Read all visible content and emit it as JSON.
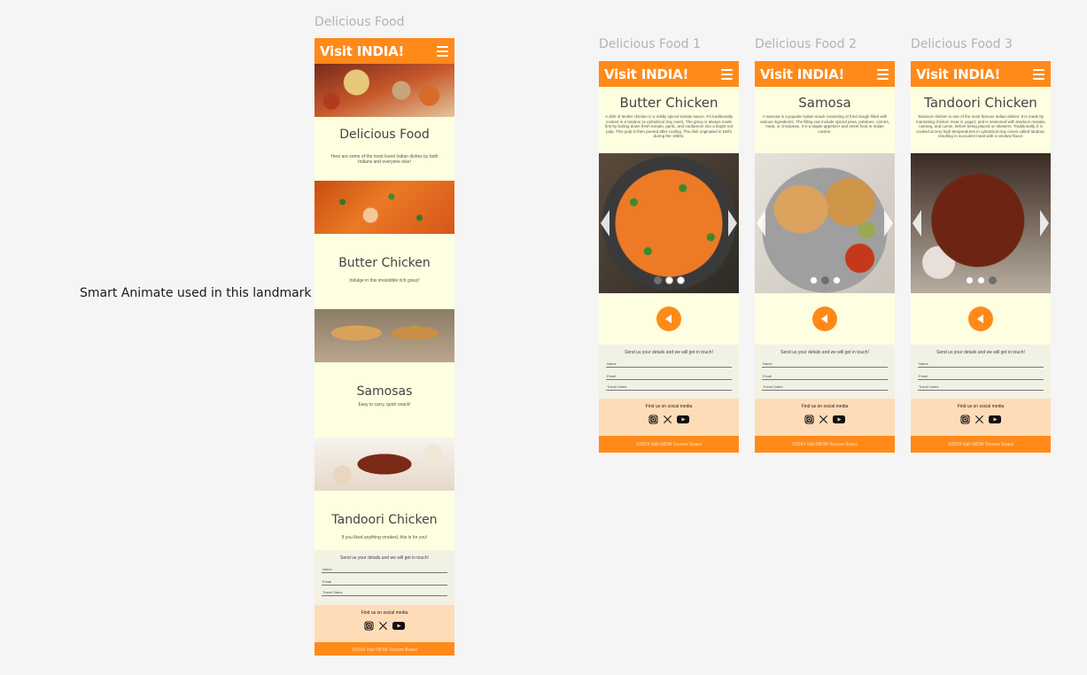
{
  "note": "Smart Animate used in this landmark",
  "brand": "Visit INDIA!",
  "main": {
    "frame_label": "Delicious Food",
    "intro_title": "Delicious Food",
    "intro_text": "Here are some of the most loved Indian dishes by both Indians and everyone else!",
    "items": [
      {
        "title": "Butter Chicken",
        "text": "Indulge in this irresistible rich gravy!"
      },
      {
        "title": "Samosas",
        "text": "Easy to carry, quick snack!"
      },
      {
        "title": "Tandoori Chicken",
        "text": "If you liked anything smoked, this is for you!"
      }
    ]
  },
  "form": {
    "title": "Send us your details and we will get in touch!",
    "name": "Name",
    "email": "Email",
    "dates": "Travel Dates"
  },
  "social": {
    "title": "Find us on social media",
    "icons": [
      "instagram-icon",
      "x-icon",
      "youtube-icon"
    ]
  },
  "footer": "©2024 Visit INDIA Tourism Board",
  "details": [
    {
      "frame_label": "Delicious Food 1",
      "title": "Butter Chicken",
      "text": "A dish of tender chicken in a mildly spiced tomato sauce. It's traditionally cooked in a tandoor (a cylindrical clay oven). The gravy is always made first by boiling down fresh tomato, garlic, and cardamom into a bright red pulp. This pulp is then pureed after cooling. The dish originated in Delhi during the 1950s.",
      "active_dot": 0
    },
    {
      "frame_label": "Delicious Food 2",
      "title": "Samosa",
      "text": "A samosa is a popular Indian snack consisting of fried dough filled with various ingredients. The filling can include spiced peas, potatoes, carrots, meat, or chickpeas. It is a staple appetizer and street food in Indian cuisine.",
      "active_dot": 1
    },
    {
      "frame_label": "Delicious Food 3",
      "title": "Tandoori Chicken",
      "text": "Tandoori chicken is one of the most famous Indian dishes. It is made by marinating chicken meat in yogurt, and is seasoned with tandoori masala, nutmeg, and cumin, before being placed on skewers. Traditionally, it is cooked at very high temperatures in cylindrical clay ovens called tandoor, resulting in succulent meat with a smokey flavor.",
      "active_dot": 2
    }
  ],
  "colors": {
    "brand": "#ff8a1a",
    "background": "#fdffe0",
    "social_bg": "#ffdcb8"
  }
}
